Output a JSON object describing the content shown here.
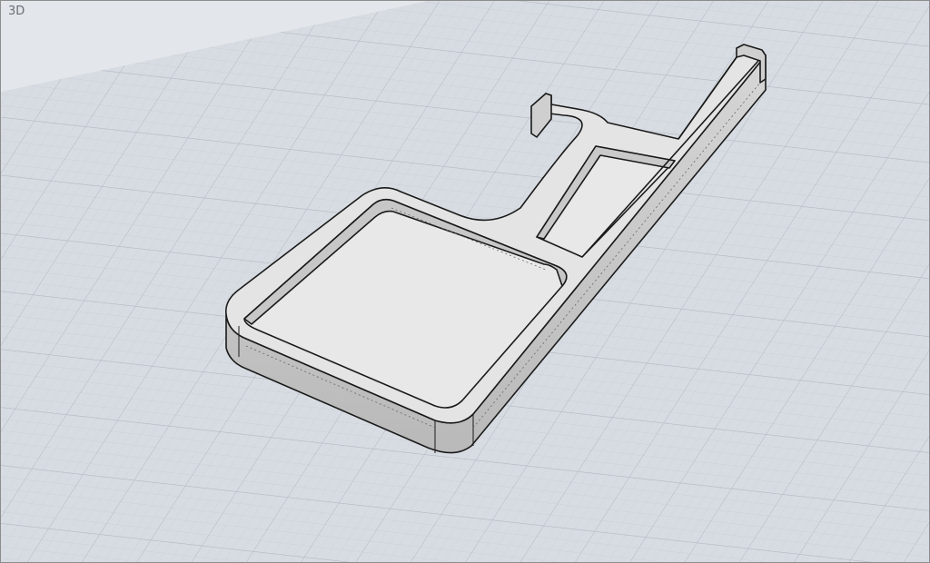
{
  "viewport": {
    "label": "3D"
  },
  "scene": {
    "background_color": "#d9dee4",
    "grid_minor_color": "#c6ccd3",
    "grid_major_color": "#aeb6bf",
    "model_face_color": "#e2e2e2",
    "model_side_color": "#c9c9c9",
    "model_edge_color": "#1a1a1a"
  }
}
